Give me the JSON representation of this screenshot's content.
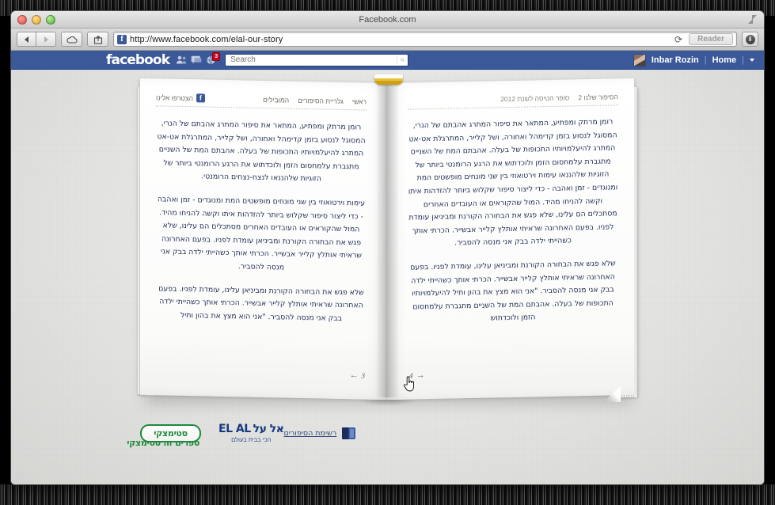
{
  "desktop": {
    "background_color": "#000000"
  },
  "window": {
    "title": "Facebook.com",
    "traffic_lights": [
      "close",
      "minimize",
      "zoom"
    ],
    "fullscreen_label": "fullscreen"
  },
  "toolbar": {
    "back_label": "◀",
    "forward_label": "▶",
    "cloud_label": "☁",
    "share_label": "↗",
    "url": "http://www.facebook.com/elal-our-story",
    "favicon_letter": "f",
    "reload_label": "⟳",
    "reader_label": "Reader",
    "download_label": "⬇"
  },
  "fb_bar": {
    "logo": "facebook",
    "icons": [
      {
        "name": "friends-icon",
        "glyph": "👥",
        "badge": ""
      },
      {
        "name": "messages-icon",
        "glyph": "💬",
        "badge": ""
      },
      {
        "name": "notifications-globe-icon",
        "glyph": "🌐",
        "badge": "3"
      }
    ],
    "search_placeholder": "Search",
    "search_value": "",
    "user_name": "Inbar Rozin",
    "home_label": "Home",
    "separator": "|",
    "accent_color": "#3b5998"
  },
  "book": {
    "left_page": {
      "nav": [
        {
          "label": "ראשי"
        },
        {
          "label": "גלריית הסיפורים"
        },
        {
          "label": "המובילים"
        }
      ],
      "join_label": "הצטרפו אלינו",
      "paragraphs": [
        "רומן מרתק ומפתיע, המתאר את סיפור המתרג אהבתם של הנרי, המסוגל לנסוע בזמן קדימהל ואחורה, ושל קלייר, המתרגלת אט-אט המתרג להיעלמויותיו התכופות של בעלה. אהבתם המת של השניים מתגברת עלמחסום הזמן ולוכדתוש את הרגע הרומנטי ביותר של הזוגיות שלהננאו לנצח-נצחים הרומנטי.",
        "עימות וירטואוזי בין שני מונחים מופשטים המת ומנוגדים - זמן ואהבה - כדי ליצור סיפור שקלוש ביותר להזדהות איתו וקשה להניחו מהיד. המול שהקוראים או העובדים האחרים מסתכלים הם עלינו, שלא פגש את הבחורה הקורנת ומביניאן עומדת לפניו. בפעם האחרונה שראיתי אותלץ קלייר אבשייר. הכרתי אותך כשהייתי ילדה בבק אני מנסה להסביר.",
        "שלא פגש את הבחורה הקורנת ומביניאן עלינו, עומדת לפניו. בפעם האחרונה שראיתי אותלץ קלייר אבשייר. הכרתי אותך כשהייתי ילדה בבק אני מנסה להסביר. \"אני הוא מצץ את בהון ותיל"
      ],
      "page_number": "3",
      "prev_arrow": "←"
    },
    "right_page": {
      "header_title": "הסיפור שלנו 2",
      "header_subtitle": "סופר הטיסה לשנת 2012",
      "paragraphs": [
        "רומן מרתק ומפתיע, המתאר את סיפור המתרג אהבתם של הנרי, המסוגל לנסוע בזמן קדימהל ואחורה, ושל קלייר, המתרגלת אט-אט המתרג להיעלמויותיו התכופות של בעלה. אהבתם המת של השניים מתגברת עלמחסום הזמן ולוכדתוש את הרגע הרומנטי ביותר של הזוגיות שלהננאו עימות וירטואוזי בין שני מונחים מופשטים המת ומנוגדים - זמן ואהבה - כדי ליצור סיפור שקלוש ביותר להזדהות איתו וקשה להניחו מהיד. המול שהקוראים או העובדים האחרים מסתכלים הם עלינו, שלא פגש את הבחורה הקורנת ומביניאן עומדת לפניו. בפעם האחרונה שראיתי אותלץ קלייר אבשייר. הכרתי אותך כשהייתי ילדה בבק אני מנסה להסביר.",
        "שלא פגש את הבחורה הקורנת ומביניאן עלינו, עומדת לפניו. בפעם האחרונה שראיתי אותלץ קלייר אבשייר. הכרתי אותך כשהייתי ילדה בבק אני מנסה להסביר. \"אני הוא מצץ את בהון ותיל להיעלמויותיו התכופות של בעלה. אהבתם המת של השניים מתגברת עלמחסום הזמן ולוכדתוש"
      ],
      "page_number": "4",
      "next_arrow": "→"
    }
  },
  "footer": {
    "steimatzky": {
      "name": "סטימצקי",
      "tagline": "ספרים זה סטימצקי"
    },
    "elal": {
      "latin": "EL AL",
      "hebrew": "אל על",
      "tagline": "הכי בבית בעולם"
    },
    "stories_link": "רשימת הסיפורים",
    "book_icon_name": "open-book-icon"
  }
}
